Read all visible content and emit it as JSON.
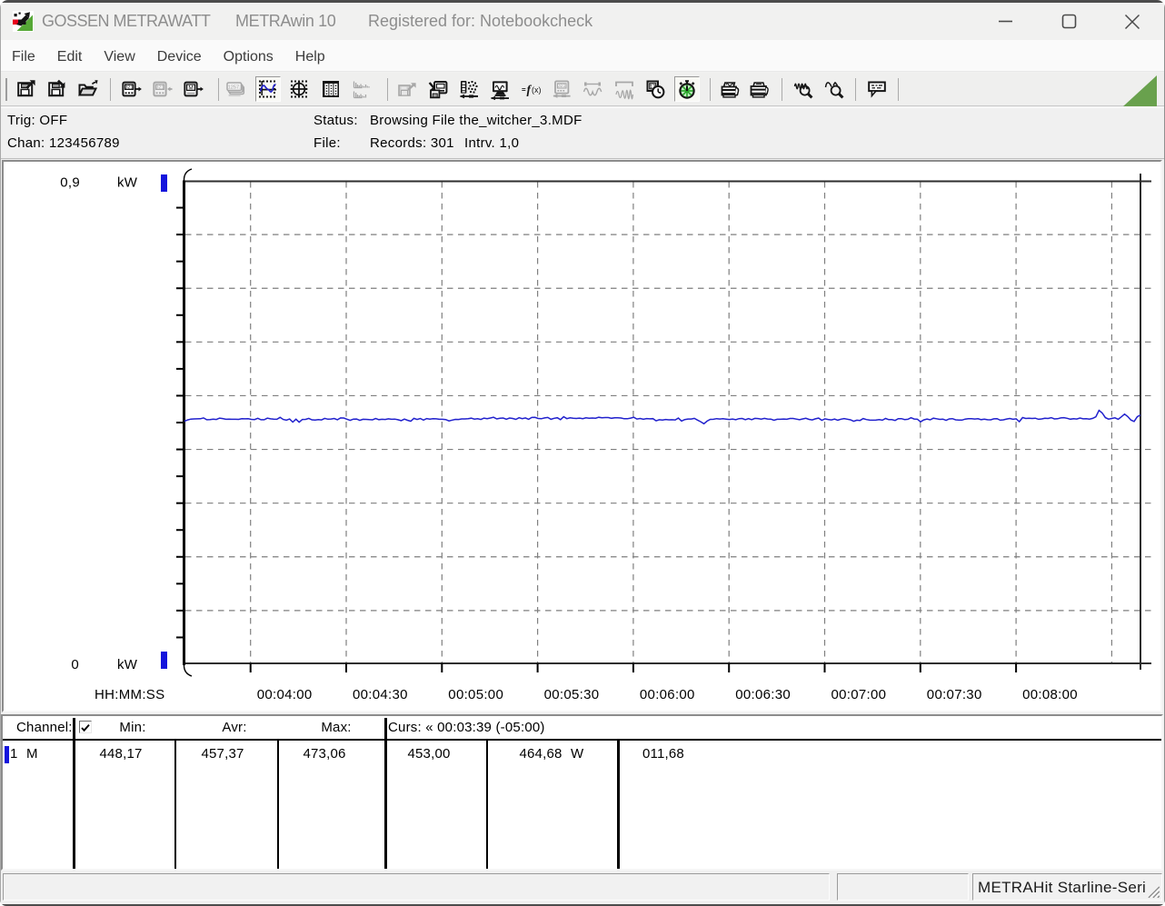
{
  "window": {
    "app_title": "GOSSEN METRAWATT",
    "product_title": "METRAwin 10",
    "registered_title": "Registered for: Notebookcheck"
  },
  "menu": {
    "items": [
      "File",
      "Edit",
      "View",
      "Device",
      "Options",
      "Help"
    ]
  },
  "toolbar": {
    "buttons": [
      {
        "icon": "save-export",
        "state": "normal"
      },
      {
        "icon": "save-import",
        "state": "normal"
      },
      {
        "icon": "open-file",
        "state": "normal"
      },
      {
        "icon": "device-read",
        "state": "normal"
      },
      {
        "icon": "device-write",
        "state": "disabled"
      },
      {
        "icon": "device-memory",
        "state": "normal"
      },
      {
        "icon": "view-multimeter",
        "state": "disabled"
      },
      {
        "icon": "view-chart",
        "state": "selected"
      },
      {
        "icon": "view-scope",
        "state": "normal"
      },
      {
        "icon": "view-table",
        "state": "normal"
      },
      {
        "icon": "view-histogram",
        "state": "disabled"
      },
      {
        "icon": "export-data",
        "state": "disabled"
      },
      {
        "icon": "import-data",
        "state": "normal"
      },
      {
        "icon": "channel-settings",
        "state": "normal"
      },
      {
        "icon": "device-monitor",
        "state": "normal"
      },
      {
        "icon": "formula",
        "state": "normal"
      },
      {
        "icon": "device-config",
        "state": "disabled"
      },
      {
        "icon": "waveform-single",
        "state": "disabled"
      },
      {
        "icon": "waveform-burst",
        "state": "disabled"
      },
      {
        "icon": "schedule",
        "state": "normal"
      },
      {
        "icon": "stopwatch",
        "state": "selected"
      },
      {
        "icon": "print-preview",
        "state": "normal"
      },
      {
        "icon": "print",
        "state": "normal"
      },
      {
        "icon": "zoom-signal",
        "state": "normal"
      },
      {
        "icon": "zoom-out",
        "state": "normal"
      },
      {
        "icon": "annotation",
        "state": "normal"
      }
    ]
  },
  "info_panel": {
    "trig_label": "Trig:",
    "trig_value": "OFF",
    "chan_label": "Chan:",
    "chan_value": "123456789",
    "status_label": "Status:",
    "status_value": "Browsing File the_witcher_3.MDF",
    "file_label": "File:",
    "file_records": "Records: 301",
    "file_interval": "Intrv. 1,0"
  },
  "chart_data": {
    "type": "line",
    "title": "",
    "xlabel": "HH:MM:SS",
    "ylabel_unit": "kW",
    "y_top_label": "0,9",
    "y_bottom_label": "0",
    "ylim_kw": [
      0,
      0.9
    ],
    "x_tick_labels": [
      "00:04:00",
      "00:04:30",
      "00:05:00",
      "00:05:30",
      "00:06:00",
      "00:06:30",
      "00:07:00",
      "00:07:30",
      "00:08:00"
    ],
    "x_start_time": "00:03:39",
    "x_end_time": "00:08:39",
    "x_window_seconds": 300,
    "sample_interval_s": 1.0,
    "records": 301,
    "grid": true,
    "line_color": "#2121cd",
    "channel_marker_color": "#1414dc",
    "series": [
      {
        "name": "1",
        "unit": "W",
        "values_w": [
          453.0,
          455.4,
          456.8,
          457.1,
          457.38,
          457.47,
          459.01,
          455.72,
          455.77,
          456.85,
          456.1,
          458.72,
          457.79,
          456.49,
          456.69,
          456.5,
          456.44,
          456.32,
          457.53,
          457.43,
          457.5,
          456.37,
          455.99,
          458.45,
          455.71,
          455.67,
          458.51,
          457.41,
          456.67,
          456.53,
          460.01,
          456.2,
          455.02,
          456.94,
          451.23,
          456.66,
          451.09,
          456.15,
          456.29,
          458.21,
          455.48,
          455.06,
          456.05,
          455.33,
          458.18,
          456.69,
          457.06,
          458.02,
          455.59,
          459.02,
          458.88,
          456.66,
          454.51,
          456.91,
          457.04,
          454.46,
          456.53,
          456.4,
          455.77,
          455.41,
          457.91,
          455.78,
          456.51,
          456.1,
          457.37,
          456.5,
          456.8,
          455.66,
          453.93,
          456.87,
          454.57,
          453.03,
          458.12,
          456.23,
          457.99,
          455.06,
          457.93,
          456.91,
          457.45,
          457.33,
          456.51,
          456.51,
          455.97,
          453.46,
          455.05,
          456.4,
          456.21,
          457.21,
          457.12,
          457.63,
          458.46,
          456.92,
          457.55,
          456.15,
          458.66,
          457.67,
          458.83,
          460.21,
          457.26,
          458.29,
          458.93,
          456.72,
          458.81,
          458.07,
          456.38,
          459.32,
          457.61,
          459.12,
          456.48,
          459.84,
          460.1,
          457.95,
          457.54,
          459.11,
          459.85,
          456.59,
          458.39,
          459.43,
          455.83,
          461.27,
          457.7,
          459.21,
          458.33,
          457.98,
          458.76,
          457.71,
          459.24,
          458.53,
          458.85,
          458.5,
          460.21,
          459.14,
          459.8,
          459.75,
          458.4,
          459.42,
          459.22,
          458.79,
          457.46,
          457.55,
          458.62,
          460.24,
          456.93,
          458.03,
          456.72,
          457.78,
          457.35,
          457.76,
          453.63,
          455.62,
          455.21,
          456.14,
          455.49,
          455.58,
          455.31,
          458.62,
          453.28,
          456.07,
          457.09,
          457.07,
          458.19,
          455.0,
          452.0,
          448.17,
          453.2,
          456.3,
          456.46,
          457.63,
          456.96,
          457.55,
          456.86,
          456.15,
          456.98,
          455.84,
          457.66,
          458.01,
          455.83,
          457.68,
          455.81,
          458.19,
          457.87,
          456.81,
          458.19,
          457.07,
          456.89,
          454.69,
          456.46,
          456.5,
          456.93,
          456.47,
          458.01,
          458.06,
          456.8,
          455.59,
          457.24,
          458.3,
          456.37,
          455.39,
          457.31,
          458.68,
          454.61,
          457.39,
          456.14,
          455.35,
          456.77,
          454.89,
          456.62,
          457.94,
          456.62,
          455.47,
          452.75,
          454.9,
          454.32,
          457.93,
          455.99,
          455.15,
          454.89,
          455.13,
          455.9,
          454.9,
          458.01,
          455.85,
          455.76,
          454.29,
          457.77,
          457.64,
          455.93,
          456.52,
          459.41,
          457.0,
          456.68,
          451.71,
          455.24,
          456.78,
          455.48,
          458.52,
          457.48,
          456.26,
          456.85,
          454.51,
          457.11,
          457.68,
          455.56,
          455.13,
          454.95,
          456.79,
          457.54,
          457.67,
          456.99,
          457.6,
          455.78,
          456.73,
          455.74,
          455.56,
          457.42,
          457.67,
          454.9,
          455.47,
          456.96,
          457.97,
          456.53,
          457.29,
          452.13,
          459.72,
          458.03,
          458.49,
          458.1,
          458.49,
          456.45,
          457.21,
          458.35,
          458.08,
          459.51,
          457.17,
          457.56,
          459.11,
          459.6,
          458.29,
          456.7,
          457.6,
          457.04,
          458.92,
          457.35,
          457.68,
          456.9,
          458.2,
          461.0,
          473.06,
          468.2,
          459.6,
          456.8,
          458.0,
          459.2,
          456.5,
          461.0,
          466.2,
          461.6,
          455.1,
          452.4,
          461.2,
          464.68
        ]
      }
    ]
  },
  "channel_table": {
    "header": {
      "channel": "Channel:",
      "checkbox_checked": true,
      "min": "Min:",
      "avr": "Avr:",
      "max": "Max:",
      "cursors": "Curs: « 00:03:39 (-05:00)"
    },
    "row": {
      "channel_num": "1",
      "mode": "M",
      "min": "448,17",
      "avr": "457,37",
      "max": "473,06",
      "cursor1": "453,00",
      "cursor2": "464,68",
      "unit": "W",
      "delta": "011,68"
    }
  },
  "statusbar": {
    "device_name": "METRAHit Starline-Seri"
  },
  "colors": {
    "accent_green": "#69a14d",
    "chart_line_blue": "#2121cd",
    "marker_blue": "#1414dc",
    "titlebar_text": "#8b8b8d"
  }
}
